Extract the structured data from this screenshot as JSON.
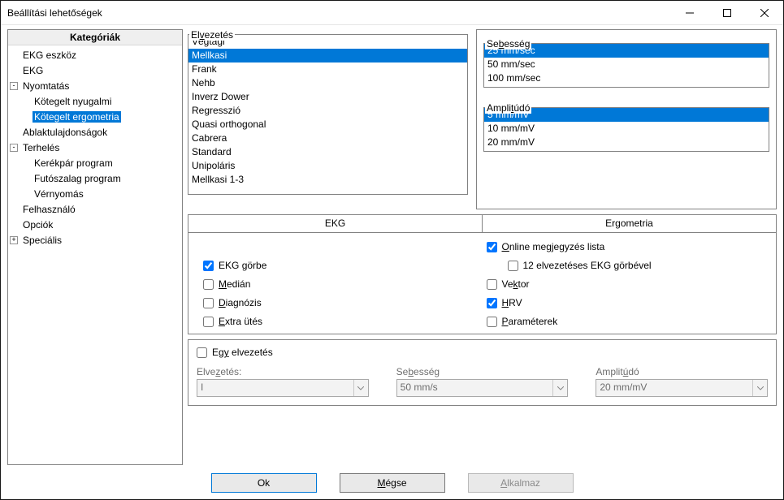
{
  "window": {
    "title": "Beállítási lehetőségek"
  },
  "tree": {
    "header": "Kategóriák",
    "items": [
      {
        "label": "EKG eszköz",
        "indent": 0,
        "toggle": null
      },
      {
        "label": "EKG",
        "indent": 0,
        "toggle": null
      },
      {
        "label": "Nyomtatás",
        "indent": 0,
        "toggle": "-"
      },
      {
        "label": "Kötegelt nyugalmi",
        "indent": 1,
        "toggle": null
      },
      {
        "label": "Kötegelt ergometria",
        "indent": 1,
        "toggle": null,
        "selected": true
      },
      {
        "label": "Ablaktulajdonságok",
        "indent": 0,
        "toggle": null
      },
      {
        "label": "Terhelés",
        "indent": 0,
        "toggle": "-"
      },
      {
        "label": "Kerékpár program",
        "indent": 1,
        "toggle": null
      },
      {
        "label": "Futószalag program",
        "indent": 1,
        "toggle": null
      },
      {
        "label": "Vérnyomás",
        "indent": 1,
        "toggle": null
      },
      {
        "label": "Felhasználó",
        "indent": 0,
        "toggle": null
      },
      {
        "label": "Opciók",
        "indent": 0,
        "toggle": null
      },
      {
        "label": "Speciális",
        "indent": 0,
        "toggle": "+"
      }
    ]
  },
  "leads": {
    "legend_html": "El<span class='u'>v</span>ezetés",
    "items": [
      "Végtagi",
      "Mellkasi",
      "Frank",
      "Nehb",
      "Inverz Dower",
      "Regresszió",
      "Quasi orthogonal",
      "Cabrera",
      "Standard",
      "Unipoláris",
      "Mellkasi 1-3"
    ],
    "selected_index": 1
  },
  "speed": {
    "legend_html": "Se<span class='u'>b</span>esség",
    "items": [
      "25 mm/sec",
      "50 mm/sec",
      "100 mm/sec"
    ],
    "selected_index": 0
  },
  "amplitude": {
    "legend_html": "Ampli<span class='u'>t</span>údó",
    "items": [
      "5 mm/mV",
      "10 mm/mV",
      "20 mm/mV"
    ],
    "selected_index": 0
  },
  "tabs": {
    "left": "EKG",
    "right": "Ergometria"
  },
  "checks": {
    "ekg_curve_html": "EKG <span class='u'>g</span>örbe",
    "median_html": "<span class='u'>M</span>edián",
    "diag_html": "<span class='u'>D</span>iagnózis",
    "extra_html": "<span class='u'>E</span>xtra ütés",
    "online_html": "<span class='u'>O</span>nline megjegyzés lista",
    "twelve_html": "12 elvezetéses EKG görbével",
    "vector_html": "Ve<span class='u'>k</span>tor",
    "hrv_html": "<span class='u'>H</span>RV",
    "param_html": "<span class='u'>P</span>araméterek"
  },
  "single": {
    "toggle_html": "Eg<span class='u'>y</span> elvezetés",
    "lead_label_html": "Elve<span class='u'>z</span>etés:",
    "lead_value": "I",
    "speed_label_html": "Se<span class='u'>b</span>esség",
    "speed_value": "50 mm/s",
    "amp_label_html": "Amplit<span class='u'>ú</span>dó",
    "amp_value": "20 mm/mV"
  },
  "buttons": {
    "ok": "Ok",
    "cancel_html": "<span class='u'>M</span>égse",
    "apply_html": "<span class='u'>A</span>lkalmaz"
  }
}
